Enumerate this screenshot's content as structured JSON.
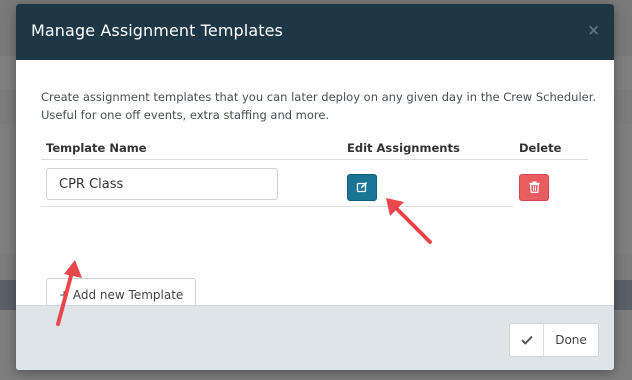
{
  "modal": {
    "title": "Manage Assignment Templates",
    "close_symbol": "×",
    "description": "Create assignment templates that you can later deploy on any given day in the Crew Scheduler. Useful for one off events, extra staffing and more.",
    "columns": {
      "name": "Template Name",
      "edit": "Edit Assignments",
      "delete": "Delete"
    },
    "templates": [
      {
        "name": "CPR Class"
      }
    ],
    "add_button": "+ Add new Template",
    "done_button": "Done"
  },
  "icons": {
    "edit": "edit-icon",
    "delete": "trash-icon",
    "done": "check-icon",
    "close": "close-icon"
  },
  "colors": {
    "header_bg": "#1e3746",
    "edit_button": "#1a7595",
    "delete_button": "#e95c60",
    "footer_bg": "#dde5e8",
    "annotation_arrow": "#e8474b"
  }
}
